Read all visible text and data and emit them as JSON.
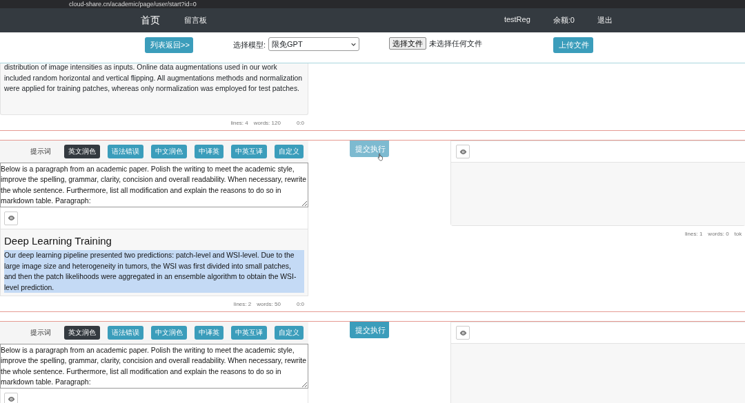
{
  "browser": {
    "url": "cloud-share.cn/academic/page/user/start?id=0"
  },
  "navbar": {
    "links": [
      {
        "label": "首页",
        "kind": "brand"
      },
      {
        "label": "留言板",
        "kind": "link"
      }
    ],
    "user": [
      "testReg",
      "余额:0",
      "退出"
    ]
  },
  "toolbar": {
    "back_button": "列表返回>>",
    "model_label": "选择模型:",
    "model_value": "限免GPT",
    "file_button": "选择文件",
    "file_status": "未选择任何文件",
    "upload_button": "上传文件"
  },
  "segments": [
    {
      "kind": "tail",
      "output": "distribution of image intensities as inputs. Online data augmentations used in our work included random horizontal and vertical flipping. All augmentations methods and normalization were applied for training patches, whereas only normalization was employed for test patches.",
      "stats": [
        "lines: 4",
        "words: 120",
        "0:0"
      ]
    },
    {
      "kind": "editor",
      "prompt_label": "提示词",
      "prompts": [
        {
          "label": "英文润色",
          "selected": true
        },
        {
          "label": "语法错误",
          "selected": false
        },
        {
          "label": "中文润色",
          "selected": false
        },
        {
          "label": "中译英",
          "selected": false
        },
        {
          "label": "中英互译",
          "selected": false
        },
        {
          "label": "自定义",
          "selected": false
        }
      ],
      "prompt_text": "Below is a paragraph from an academic paper. Polish the writing to meet the academic style, improve the spelling, grammar, clarity, concision and overall readability. When necessary, rewrite the whole sentence. Furthermore, list all modification and explain the reasons to do so in markdown table. Paragraph:",
      "preview": {
        "heading": "Deep Learning Training",
        "text": "Our deep learning pipeline presented two predictions: patch-level and WSI-level. Due to the large image size and heterogeneity in tumors, the WSI was first divided into small patches, and then the patch likelihoods were aggregated in an ensemble algorithm to obtain the WSI-level prediction.",
        "selected": true
      },
      "stats": [
        "lines: 2",
        "words: 50",
        "0:0"
      ],
      "submit": {
        "label": "提交执行",
        "hovered": true
      },
      "result_stats": [
        "lines: 1",
        "words: 0",
        "tok"
      ]
    },
    {
      "kind": "editor",
      "prompt_label": "提示词",
      "prompts": [
        {
          "label": "英文润色",
          "selected": true
        },
        {
          "label": "语法错误",
          "selected": false
        },
        {
          "label": "中文润色",
          "selected": false
        },
        {
          "label": "中译英",
          "selected": false
        },
        {
          "label": "中英互译",
          "selected": false
        },
        {
          "label": "自定义",
          "selected": false
        }
      ],
      "prompt_text": "Below is a paragraph from an academic paper. Polish the writing to meet the academic style, improve the spelling, grammar, clarity, concision and overall readability. When necessary, rewrite the whole sentence. Furthermore, list all modification and explain the reasons to do so in markdown table. Paragraph:",
      "submit": {
        "label": "提交执行",
        "hovered": false
      }
    }
  ]
}
